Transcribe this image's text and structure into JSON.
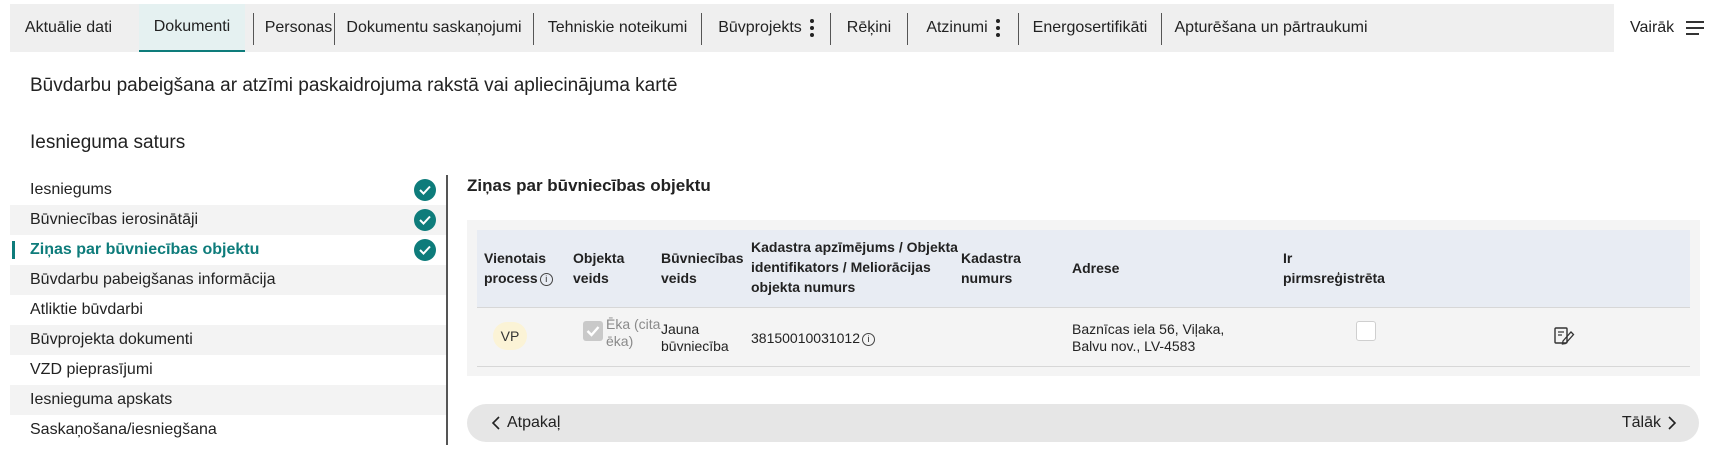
{
  "tabs": [
    {
      "label": "Aktuālie dati"
    },
    {
      "label": "Dokumenti",
      "active": true
    },
    {
      "label": "Personas"
    },
    {
      "label": "Dokumentu saskaņojumi"
    },
    {
      "label": "Tehniskie noteikumi"
    },
    {
      "label": "Būvprojekts"
    },
    {
      "label": "Rēķini"
    },
    {
      "label": "Atzinumi"
    },
    {
      "label": "Energosertifikāti"
    },
    {
      "label": "Apturēšana un pārtraukumi"
    }
  ],
  "more_label": "Vairāk",
  "page_title": "Būvdarbu pabeigšana ar atzīmi paskaidrojuma rakstā vai apliecinājuma kartē",
  "section_title": "Iesnieguma saturs",
  "nav": [
    {
      "label": "Iesniegums",
      "done": true
    },
    {
      "label": "Būvniecības ierosinātāji",
      "done": true
    },
    {
      "label": "Ziņas par būvniecības objektu",
      "done": true,
      "active": true
    },
    {
      "label": "Būvdarbu pabeigšanas informācija"
    },
    {
      "label": "Atliktie būvdarbi"
    },
    {
      "label": "Būvprojekta dokumenti"
    },
    {
      "label": "VZD pieprasījumi"
    },
    {
      "label": "Iesnieguma apskats"
    },
    {
      "label": "Saskaņošana/iesniegšana"
    }
  ],
  "main": {
    "heading": "Ziņas par būvniecības objektu",
    "table": {
      "headers": {
        "vienotais": "Vienotais process",
        "objekta_veids": "Objekta veids",
        "buvniecibas_veids": "Būvniecības veids",
        "kadastra_apz": "Kadastra apzīmējums / Objekta identifikators / Meliorācijas objekta numurs",
        "kadastra_numurs": "Kadastra numurs",
        "adrese": "Adrese",
        "pirmsregistreta": "Ir pirmsreģistrēta"
      },
      "row": {
        "vienotais": "VP",
        "objekta_veids": "Ēka (cita ēka)",
        "buvniecibas_veids": "Jauna būvniecība",
        "kadastra_apz": "38150010031012",
        "kadastra_numurs": "",
        "adrese": "Baznīcas iela 56, Viļaka, Balvu nov., LV-4583"
      }
    }
  },
  "footer": {
    "back_label": "Atpakaļ",
    "next_label": "Tālāk"
  },
  "icons": {
    "info": "info-icon",
    "check": "checkmark-circle-icon",
    "edit": "edit-document-icon",
    "kebab": "kebab-menu-icon",
    "hamburger": "hamburger-menu-icon",
    "chevron_left": "chevron-left-icon",
    "chevron_right": "chevron-right-icon"
  },
  "colors": {
    "accent": "#0e7c7b",
    "active_tab_bg": "#e5f1f1",
    "badge_bg": "#fbf3d6"
  }
}
